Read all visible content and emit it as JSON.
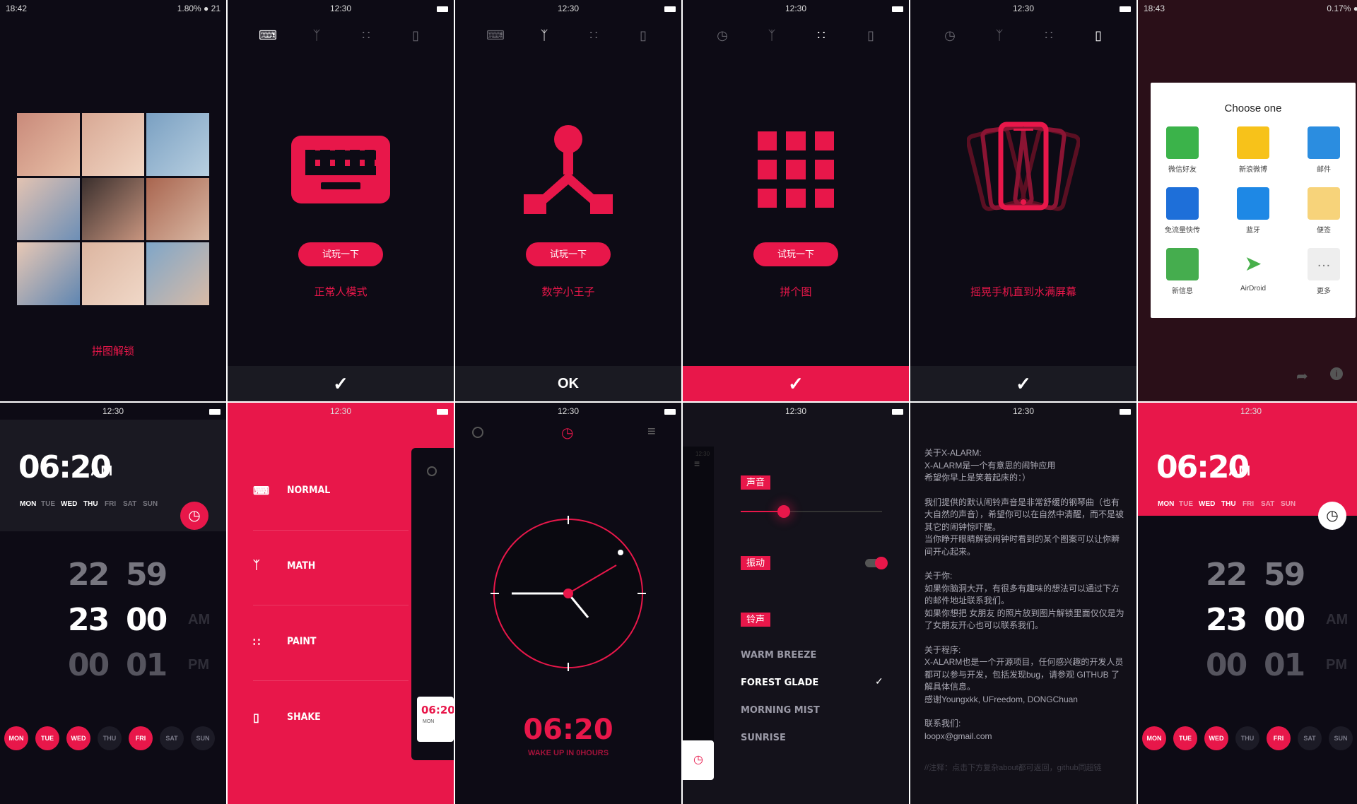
{
  "status": {
    "time_a": "18:42",
    "pct_a": "1.80",
    "batt_a": "21",
    "time_b": "12:30",
    "time_c": "18:43",
    "pct_c": "0.17"
  },
  "p1": {
    "caption": "拼图解锁"
  },
  "p2": {
    "caption": "正常人模式",
    "try": "试玩一下"
  },
  "p3": {
    "caption": "数学小王子",
    "try": "试玩一下",
    "ok": "OK"
  },
  "p4": {
    "caption": "拼个图",
    "try": "试玩一下"
  },
  "p5": {
    "caption": "摇晃手机直到水满屏幕"
  },
  "p6": {
    "title": "Choose one",
    "apps": [
      "微信好友",
      "新浪微博",
      "邮件",
      "免流量快传",
      "蓝牙",
      "便签",
      "新信息",
      "AirDroid",
      "更多"
    ]
  },
  "alarm": {
    "time": "06:20",
    "ampm": "AM",
    "weekdays": [
      "MON",
      "TUE",
      "WED",
      "THU",
      "FRI",
      "SAT",
      "SUN"
    ],
    "hours": [
      "22",
      "23",
      "00"
    ],
    "minutes": [
      "59",
      "00",
      "01"
    ],
    "meridiem": [
      "AM",
      "PM"
    ],
    "days": [
      "MON",
      "TUE",
      "WED",
      "THU",
      "FRI",
      "SAT",
      "SUN"
    ]
  },
  "menu": {
    "items": [
      "NORMAL",
      "MATH",
      "PAINT",
      "SHAKE"
    ],
    "card_time": "06:20",
    "card_day": "MON"
  },
  "clock": {
    "time": "06:20",
    "sub": "WAKE UP IN 0HOURS"
  },
  "settings": {
    "sound": "声音",
    "vibrate": "振动",
    "ringtone": "铃声",
    "ringtones": [
      "WARM BREEZE",
      "FOREST GLADE",
      "MORNING MIST",
      "SUNRISE"
    ],
    "time_label": "12:30"
  },
  "about": {
    "p1": [
      "关于X-ALARM:",
      "X-ALARM是一个有意思的闹钟应用",
      "希望你早上是笑着起床的：）"
    ],
    "p2": [
      "我们提供的默认闹铃声音是非常舒缓的钢琴曲（也有大自然的声音），希望你可以在自然中清醒，而不是被其它的闹钟惊吓醒。",
      "当你睁开眼睛解锁闹钟时看到的某个图案可以让你瞬间开心起来。"
    ],
    "p3": [
      "关于你:",
      "如果你脑洞大开，有很多有趣味的想法可以通过下方的邮件地址联系我们。",
      "如果你想把 女朋友 的照片放到图片解锁里面仅仅是为了女朋友开心也可以联系我们。"
    ],
    "p4": [
      "关于程序:",
      "X-ALARM也是一个开源项目，任何感兴趣的开发人员都可以参与开发，包括发现bug，请参观 GITHUB 了解具体信息。",
      "感谢Youngxkk, UFreedom, DONGChuan"
    ],
    "p5": [
      "联系我们:",
      "loopx@gmail.com"
    ],
    "footer": "//注释：点击下方复杂about都可返回，github同超链"
  },
  "colors": {
    "accent": "#e8174a",
    "bg": "#0d0b15"
  }
}
